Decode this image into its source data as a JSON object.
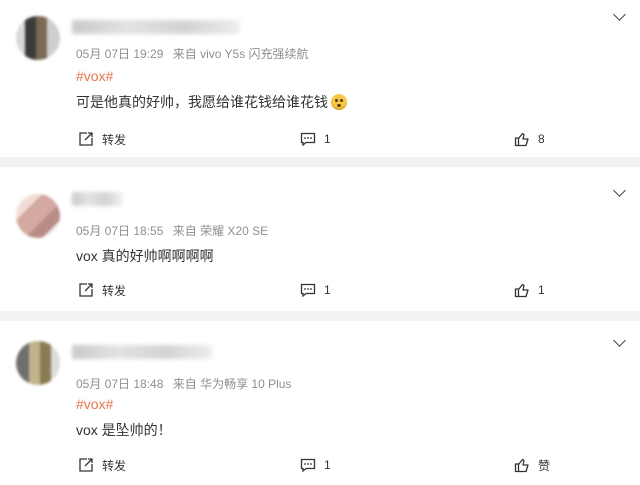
{
  "comments": [
    {
      "date": "05月 07日 19:29",
      "device": "来自 vivo Y5s 闪充强续航",
      "tag": "#vox#",
      "text": "可是他真的好帅，我愿给谁花钱给谁花钱",
      "repost_label": "转发",
      "comment_count": "1",
      "like_count": "8"
    },
    {
      "date": "05月 07日 18:55",
      "device": "来自 荣耀 X20 SE",
      "tag": "",
      "text": "vox 真的好帅啊啊啊啊",
      "repost_label": "转发",
      "comment_count": "1",
      "like_count": "1"
    },
    {
      "date": "05月 07日 18:48",
      "device": "来自 华为畅享 10 Plus",
      "tag": "#vox#",
      "text": "vox 是坠帅的！",
      "repost_label": "转发",
      "comment_count": "1",
      "like_count": "赞"
    }
  ],
  "colors": {
    "tag": "#eb7350",
    "background": "#f2f2f2",
    "card": "#ffffff",
    "meta": "#8f8f8f"
  },
  "icons": [
    "repost-icon",
    "comment-icon",
    "like-icon",
    "chevron-down-icon",
    "emoji-icon"
  ]
}
